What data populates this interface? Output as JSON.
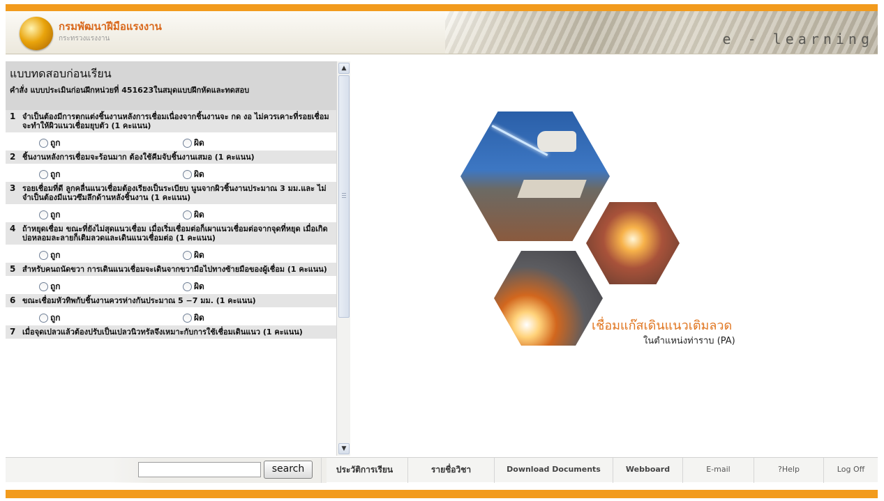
{
  "header": {
    "org_name": "กรมพัฒนาฝีมือแรงงาน",
    "org_sub": "กระทรวงแรงงาน",
    "banner_text": "e - learning"
  },
  "quiz": {
    "title": "แบบทดสอบก่อนเรียน",
    "instruction": "คำสั่ง  แบบประเมินก่อนฝึกหน่วยที่ 451623ในสมุดแบบฝึกหัดและทดสอบ",
    "option_true": "ถูก",
    "option_false": "ผิด",
    "questions": [
      {
        "num": "1",
        "text": "จำเป็นต้องมีการตกแต่งชิ้นงานหลังการเชื่อมเนื่องจากชิ้นงานจะ กด งอ ไม่ควรเคาะที่รอยเชื่อม จะทำให้ผิวแนวเชื่อมยุบตัว (1 คะแนน)"
      },
      {
        "num": "2",
        "text": "ชิ้นงานหลังการเชื่อมจะร้อนมาก ต้องใช้คีมจับชิ้นงานเสมอ (1 คะแนน)"
      },
      {
        "num": "3",
        "text": "รอยเชื่อมที่ดี ลูกคลื่นแนวเชื่อมต้องเรียงเป็นระเบียบ นูนจากผิวชิ้นงานประมาณ 3 มม.และ ไม่จำเป็นต้องมีแนวซึมลึกด้านหลังชิ้นงาน (1 คะแนน)"
      },
      {
        "num": "4",
        "text": "ถ้าหยุดเชื่อม ขณะที่ยังไม่สุดแนวเชื่อม เมื่อเริ่มเชื่อมต่อก็เผาแนวเชื่อมต่อจากจุดที่หยุด เมื่อเกิดบ่อหลอมละลายก็เติมลวดและเดินแนวเชื่อมต่อ (1 คะแนน)"
      },
      {
        "num": "5",
        "text": "สำหรับคนถนัดขวา การเดินแนวเชื่อมจะเดินจากขวามือไปทางซ้ายมือของผู้เชื่อม (1 คะแนน)"
      },
      {
        "num": "6",
        "text": "ขณะเชื่อมหัวทิพกับชิ้นงานควรห่างกันประมาณ 5 −7 มม. (1 คะแนน)"
      },
      {
        "num": "7",
        "text": "เมื่อจุดเปลวแล้วต้องปรับเป็นเปลวนิวทรัลจึงเหมาะกับการใช้เชื่อมเดินแนว (1 คะแนน)"
      }
    ]
  },
  "hero": {
    "title": "เชื่อมแก๊สเดินแนวเติมลวด",
    "subtitle": "ในตำแหน่งท่าราบ (PA)"
  },
  "toolbar": {
    "search_value": "",
    "search_label": "search",
    "history": "ประวัติการเรียน",
    "courses": "รายชื่อวิชา",
    "download": "Download Documents",
    "webboard": "Webboard",
    "email": "E-mail",
    "help": "?Help",
    "logoff": "Log Off"
  },
  "colors": {
    "accent_orange": "#f29b1d",
    "hero_title": "#e0751f"
  }
}
